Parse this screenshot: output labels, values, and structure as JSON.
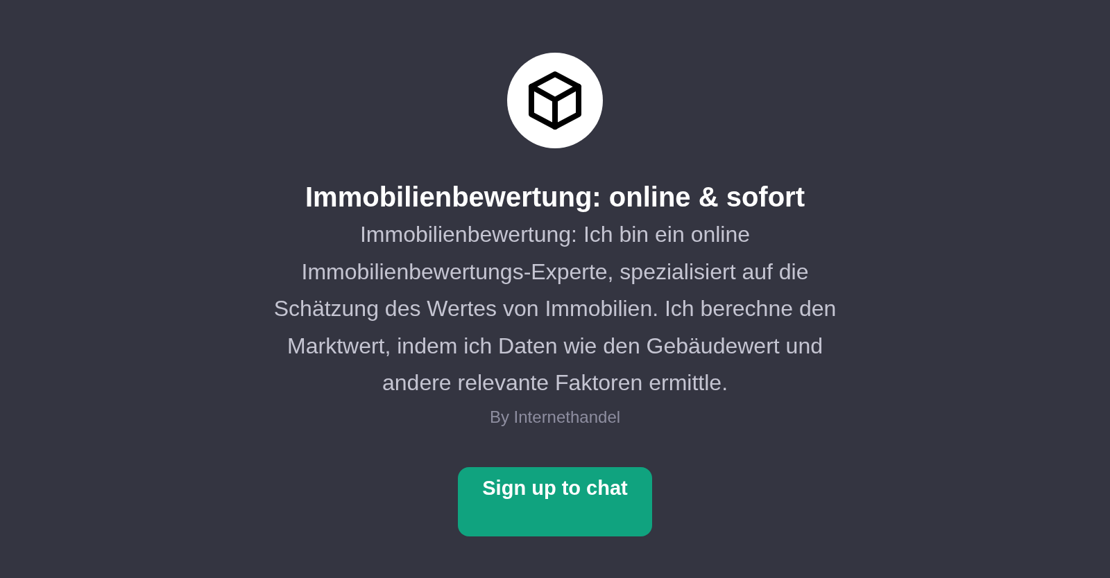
{
  "title": "Immobilienbewertung: online & sofort",
  "description": "Immobilienbewertung: Ich bin ein online Immobilienbewertungs-Experte, spezialisiert auf die Schätzung des Wertes von Immobilien. Ich berechne den Marktwert, indem ich Daten wie den Gebäudewert und andere relevante Faktoren ermittle.",
  "author": "By Internethandel",
  "button": "Sign up to chat"
}
